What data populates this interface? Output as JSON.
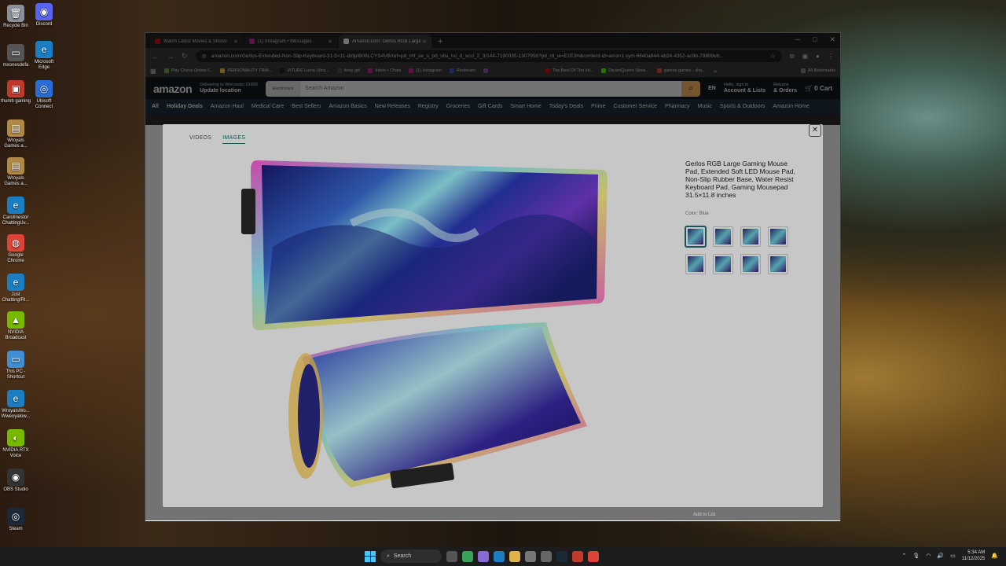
{
  "desktop_icons": [
    {
      "label": "Recycle Bin",
      "color": "#8a8f99",
      "glyph": "🗑"
    },
    {
      "label": "Discord",
      "color": "#5865f2",
      "glyph": "◉"
    },
    {
      "label": "mxonesdefa",
      "color": "#555555",
      "glyph": "▭"
    },
    {
      "label": "Microsoft Edge",
      "color": "#1b7ec2",
      "glyph": "e"
    },
    {
      "label": "thumb gaming",
      "color": "#c0392b",
      "glyph": "▣"
    },
    {
      "label": "Ubisoft Connect",
      "color": "#2a6dd6",
      "glyph": "◎"
    },
    {
      "label": "Wroyals Games a...",
      "color": "#b08a44",
      "glyph": "▤"
    },
    {
      "label": "Wroyals Games a...",
      "color": "#b08a44",
      "glyph": "▤"
    },
    {
      "label": "CarolInestor ChattingUv...",
      "color": "#1b7ec2",
      "glyph": "e"
    },
    {
      "label": "Google Chrome",
      "color": "#db4437",
      "glyph": "◍"
    },
    {
      "label": "Just ChattingIRI...",
      "color": "#1b7ec2",
      "glyph": "e"
    },
    {
      "label": "NVIDIA Broadcast",
      "color": "#76b900",
      "glyph": "▲"
    },
    {
      "label": "This PC - Shortcut",
      "color": "#3f8fd2",
      "glyph": "▭"
    },
    {
      "label": "WroyalsWo... Wweoyalow...",
      "color": "#1b7ec2",
      "glyph": "e"
    },
    {
      "label": "NVIDIA RTX Voice",
      "color": "#76b900",
      "glyph": "◐"
    },
    {
      "label": "OBS Studio",
      "color": "#333333",
      "glyph": "◉"
    },
    {
      "label": "Steam",
      "color": "#1b2838",
      "glyph": "◎"
    }
  ],
  "browser": {
    "tabs": [
      {
        "title": "Watch Latest Movies & Shows",
        "color": "#e50914",
        "active": false
      },
      {
        "title": "(1) Instagram • Messages",
        "color": "#d6249f",
        "active": false
      },
      {
        "title": "Amazon.com: Gerlos RGB Large",
        "color": "#ffffff",
        "active": true
      }
    ],
    "new_tab": "+",
    "window_controls": {
      "minimize": "─",
      "maximize": "□",
      "close": "✕"
    },
    "url": "amazon.com/Gerlos-Extended-Non-Slip-Keyboard-31-5×11-8/dp/B08LCYS4VB/ref=pd_rhf_se_s_pd_sbs_rvi_d_sccl_2_3/144-7190035-1307956?pd_rd_w=E1E3H&content-id=amzn1.sym.6640a844-ab24-4352-ac9b-78899e6...",
    "bookmarks": [
      {
        "label": "Play Chess Online f...",
        "color": "#7fa650"
      },
      {
        "label": "PERSONALITY TRAI...",
        "color": "#f2c94c"
      },
      {
        "label": "VITURE Luma Ultra...",
        "color": "#222222"
      },
      {
        "label": "fenty girl",
        "color": "#555555"
      },
      {
        "label": "Inbox • Chats",
        "color": "#d6249f"
      },
      {
        "label": "(1) Instagram",
        "color": "#d6249f"
      },
      {
        "label": "Restream",
        "color": "#3b5bdb"
      },
      {
        "label": "",
        "color": "#9b59b6"
      },
      {
        "label": "The Best Of The Int...",
        "color": "#e50914"
      },
      {
        "label": "DezenQueen Strea...",
        "color": "#53fc18"
      },
      {
        "label": "games games - sha...",
        "color": "#e74c3c"
      }
    ],
    "all_bookmarks": "All Bookmarks"
  },
  "amazon": {
    "logo": "amazon",
    "deliver_line1": "Delivering to Worcester 01606",
    "deliver_line2": "Update location",
    "search_category": "Electronics",
    "search_placeholder": "Search Amazon",
    "lang": "EN",
    "account_line1": "Hello, sign in",
    "account_line2": "Account & Lists",
    "returns_line1": "Returns",
    "returns_line2": "& Orders",
    "cart_count": "0",
    "cart_label": "Cart",
    "subnav": [
      "All",
      "Holiday Deals",
      "Amazon Haul",
      "Medical Care",
      "Best Sellers",
      "Amazon Basics",
      "New Releases",
      "Registry",
      "Groceries",
      "Gift Cards",
      "Smart Home",
      "Today's Deals",
      "Prime",
      "Customer Service",
      "Pharmacy",
      "Music",
      "Sports & Outdoors",
      "Amazon Home"
    ]
  },
  "modal": {
    "tabs": [
      "VIDEOS",
      "IMAGES"
    ],
    "active_tab": "IMAGES",
    "close": "✕",
    "product_title": "Gerlos RGB Large Gaming Mouse Pad, Extended Soft LED Mouse Pad, Non-Slip Rubber Base, Water Resist Keyboard Pad, Gaming Mousepad 31.5×11.8 inches",
    "color_label": "Color: Blue",
    "thumbnail_count": 8,
    "selected_thumbnail": 1,
    "brand_mark": "Gerlos"
  },
  "behind_modal": {
    "add_to_list": "Add to List"
  },
  "taskbar": {
    "search_label": "Search",
    "time": "5:34 AM",
    "date": "11/12/2025"
  }
}
